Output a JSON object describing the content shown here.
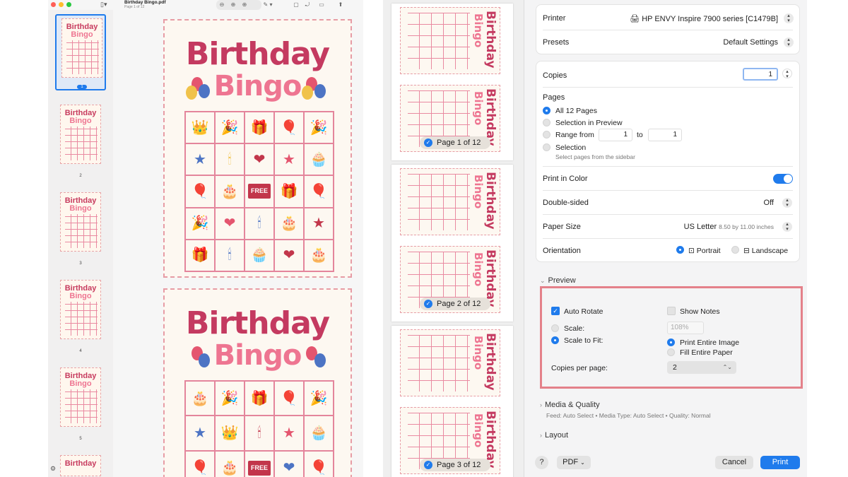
{
  "preview": {
    "title": "Birthday Bingo.pdf",
    "subtitle": "Page 1 of 12",
    "thumb_numbers": [
      "1",
      "2",
      "3",
      "4",
      "5",
      ""
    ],
    "page_title_line1": "Birthday",
    "page_title_line2": "Bingo",
    "thumb_title_line1": "Birthday",
    "thumb_title_line2": "Bingo",
    "free_label": "FREE",
    "grid1": [
      "👑",
      "🎉",
      "🎁",
      "🎈",
      "🎉",
      "★",
      "🕯",
      "❤",
      "★",
      "🧁",
      "🎈",
      "🎂",
      "FREE",
      "🎁",
      "🎈",
      "🎉",
      "❤",
      "🕯",
      "🎂",
      "★",
      "🎁",
      "🕯",
      "🧁",
      "❤",
      "🎂"
    ],
    "grid2": [
      "🎂",
      "🎉",
      "🎁",
      "🎈",
      "🎉",
      "★",
      "👑",
      "🕯",
      "★",
      "🧁",
      "🎈",
      "🎂",
      "FREE",
      "❤",
      "🎈"
    ]
  },
  "print": {
    "page_badges": [
      "Page 1 of 12",
      "Page 2 of 12",
      "Page 3 of 12"
    ],
    "mini_title1": "Birthday",
    "mini_title2": "Bingo",
    "printer_label": "Printer",
    "printer_value": "HP ENVY Inspire 7900 series [C1479B]",
    "presets_label": "Presets",
    "presets_value": "Default Settings",
    "copies_label": "Copies",
    "copies_value": "1",
    "pages_label": "Pages",
    "all_pages": "All 12 Pages",
    "selection_preview": "Selection in Preview",
    "range_from": "Range from",
    "range_from_value": "1",
    "range_to": "to",
    "range_to_value": "1",
    "selection": "Selection",
    "selection_note": "Select pages from the sidebar",
    "print_color_label": "Print in Color",
    "double_sided_label": "Double-sided",
    "double_sided_value": "Off",
    "paper_size_label": "Paper Size",
    "paper_size_value": "US Letter",
    "paper_size_note": "8.50 by 11.00 inches",
    "orientation_label": "Orientation",
    "portrait": "Portrait",
    "landscape": "Landscape",
    "preview_section": "Preview",
    "auto_rotate": "Auto Rotate",
    "show_notes": "Show Notes",
    "scale": "Scale:",
    "scale_value": "108%",
    "scale_to_fit": "Scale to Fit:",
    "print_entire_image": "Print Entire Image",
    "fill_entire_paper": "Fill Entire Paper",
    "copies_per_page_label": "Copies per page:",
    "copies_per_page_value": "2",
    "media_quality": "Media & Quality",
    "media_quality_note": "Feed: Auto Select • Media Type: Auto Select • Quality: Normal",
    "layout_section": "Layout",
    "help": "?",
    "pdf": "PDF",
    "cancel": "Cancel",
    "print_btn": "Print"
  },
  "colors": {
    "accent": "#1f7bec",
    "highlight": "#e4818a",
    "title": "#c43a60"
  },
  "icons": [
    "sidebar-icon",
    "zoom-out-icon",
    "zoom-in-icon",
    "markup-icon",
    "share-icon",
    "settings-icon",
    "checkmark-icon",
    "chevron-icon",
    "stepper-icon"
  ]
}
